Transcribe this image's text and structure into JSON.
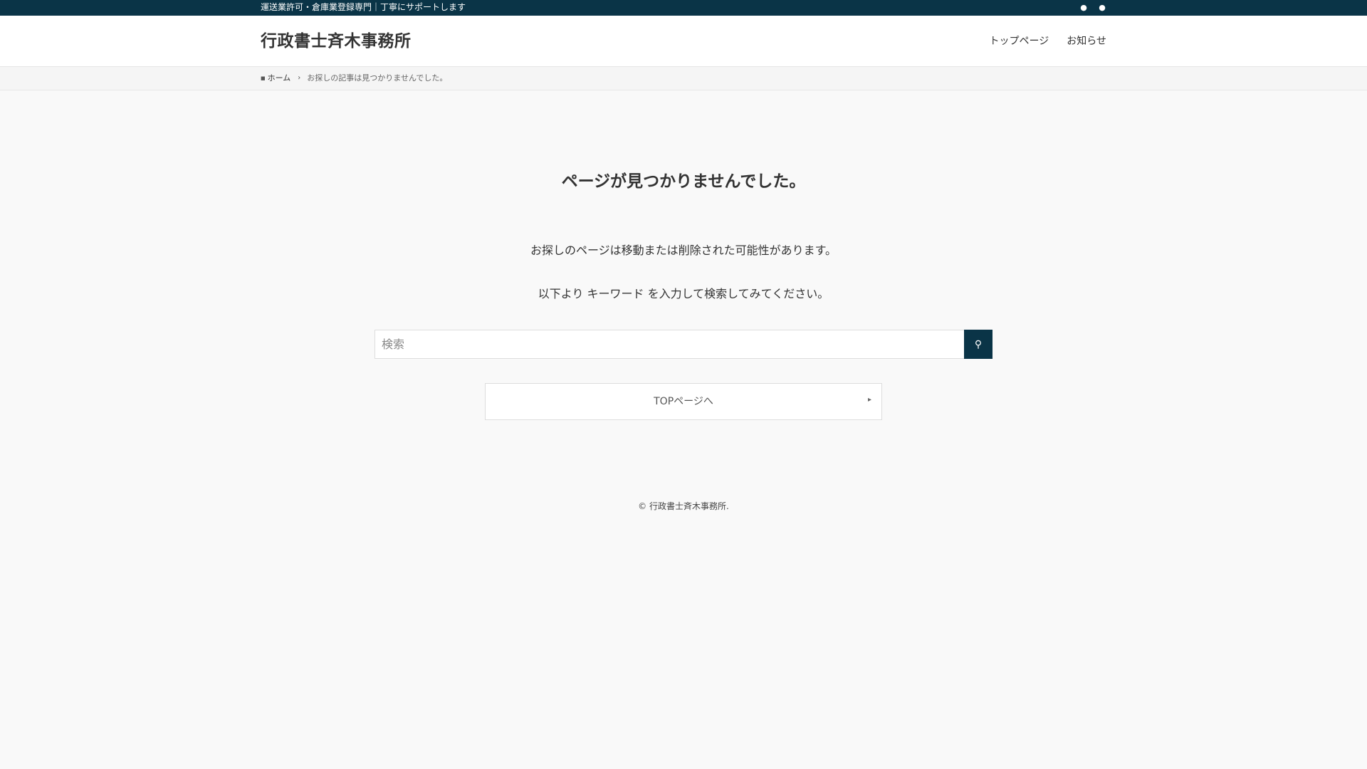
{
  "topbar": {
    "tagline": "運送業許可・倉庫業登録専門｜丁寧にサポートします",
    "icons": [
      "twitter-icon",
      "rss-icon"
    ]
  },
  "header": {
    "site_title": "行政書士斉木事務所",
    "nav": [
      {
        "label": "トップページ"
      },
      {
        "label": "お知らせ"
      }
    ]
  },
  "breadcrumb": {
    "home_label": "ホーム",
    "current": "お探しの記事は見つかりませんでした。"
  },
  "main": {
    "heading": "ページが見つかりませんでした。",
    "message1": "お探しのページは移動または削除された可能性があります。",
    "message2": "以下より キーワード を入力して検索してみてください。",
    "search": {
      "placeholder": "検索",
      "value": ""
    },
    "top_button_label": "TOPページへ"
  },
  "footer": {
    "copyright": "© 行政書士斉木事務所."
  },
  "colors": {
    "accent": "#0a3447",
    "background": "#f9f9f9",
    "text": "#333333"
  }
}
